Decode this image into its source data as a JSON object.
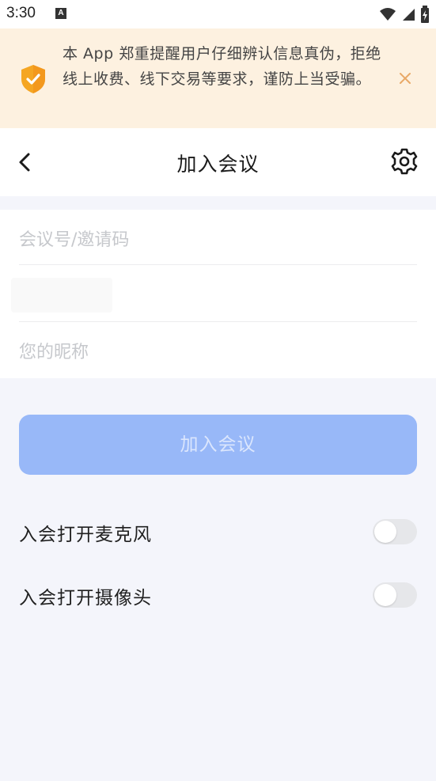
{
  "status_bar": {
    "time": "3:30",
    "notification_icon": "A"
  },
  "warning": {
    "text": "本 App 郑重提醒用户仔细辨认信息真伪，拒绝线上收费、线下交易等要求，谨防上当受骗。",
    "icon": "shield-check-icon",
    "accent_color": "#f5a623"
  },
  "nav": {
    "title": "加入会议"
  },
  "form": {
    "meeting_id_placeholder": "会议号/邀请码",
    "nickname_placeholder": "您的昵称"
  },
  "join_button": {
    "label": "加入会议",
    "color": "#98b8f8"
  },
  "options": [
    {
      "label": "入会打开麦克风",
      "enabled": false
    },
    {
      "label": "入会打开摄像头",
      "enabled": false
    }
  ]
}
